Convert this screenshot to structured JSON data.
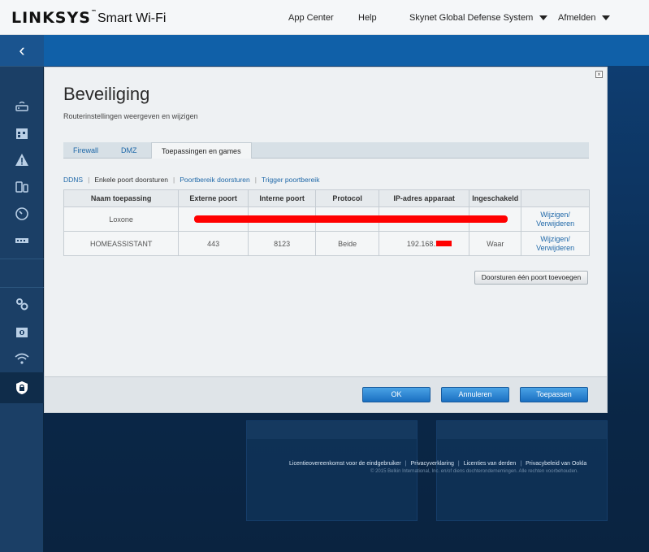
{
  "header": {
    "brand": "LINKSYS",
    "brand_sub": "Smart Wi-Fi",
    "nav": {
      "app_center": "App Center",
      "help": "Help",
      "network": "Skynet Global Defense System",
      "logout": "Afmelden"
    }
  },
  "sidebar": {
    "back_icon": "chevron-left-icon",
    "items": [
      "router-icon",
      "calendar-icon",
      "warning-icon",
      "devices-icon",
      "clock-icon",
      "network-icon",
      "gear-icon",
      "backup-icon",
      "wifi-icon",
      "security-lock-icon"
    ]
  },
  "modal": {
    "title": "Beveiliging",
    "subtitle": "Routerinstellingen weergeven en wijzigen",
    "tabs": [
      "Firewall",
      "DMZ",
      "Toepassingen en games"
    ],
    "sublinks": [
      "DDNS",
      "Enkele poort doorsturen",
      "Poortbereik doorsturen",
      "Trigger poortbereik"
    ],
    "table": {
      "headers": [
        "Naam toepassing",
        "Externe poort",
        "Interne poort",
        "Protocol",
        "IP-adres apparaat",
        "Ingeschakeld",
        ""
      ],
      "rows": [
        {
          "name": "Loxone",
          "ext": "",
          "int": "",
          "proto": "",
          "ip": "",
          "enabled": "",
          "edit": "Wijzigen/",
          "delete": "Verwijderen"
        },
        {
          "name": "HOMEASSISTANT",
          "ext": "443",
          "int": "8123",
          "proto": "Beide",
          "ip": "192.168.1.",
          "enabled": "Waar",
          "edit": "Wijzigen/",
          "delete": "Verwijderen"
        }
      ]
    },
    "add_button": "Doorsturen één poort toevoegen",
    "footer": {
      "ok": "OK",
      "cancel": "Annuleren",
      "apply": "Toepassen"
    }
  },
  "footer": {
    "links": [
      "Licentieovereenkomst voor de eindgebruiker",
      "Privacyverklaring",
      "Licenties van derden",
      "Privacybeleid van Ookla"
    ],
    "copyright": "© 2015 Belkin International, Inc. en/of diens dochterondernemingen. Alle rechten voorbehouden."
  },
  "colors": {
    "link": "#1f68a8",
    "primary_button": "#1a6fc1",
    "redaction": "#ff0000"
  }
}
